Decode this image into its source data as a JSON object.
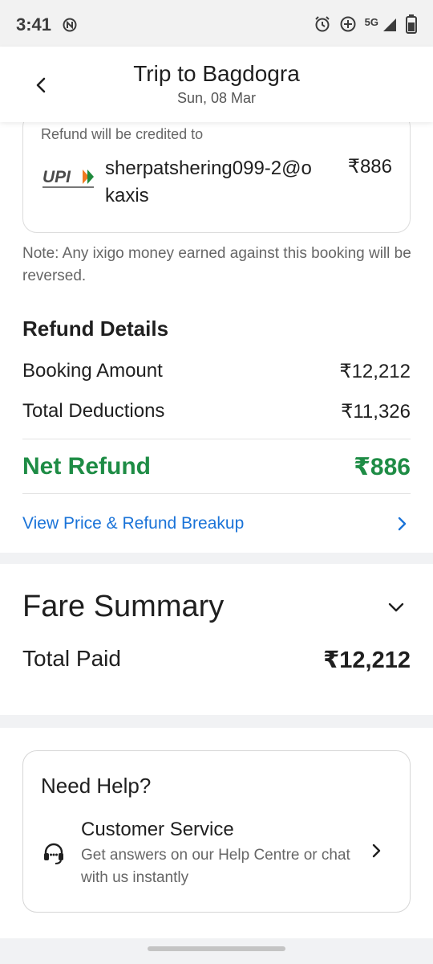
{
  "status_bar": {
    "time": "3:41",
    "network": "5G",
    "icons": [
      "alarm-icon",
      "data-saver-icon",
      "signal-icon",
      "battery-icon"
    ]
  },
  "header": {
    "title": "Trip to Bagdogra",
    "subtitle": "Sun, 08 Mar"
  },
  "refund_destination": {
    "caption": "Refund will be credited to",
    "upi_id": "sherpatshering099-2@okaxis",
    "amount": "₹886"
  },
  "note": "Note: Any ixigo money earned against this booking will be reversed.",
  "refund_details": {
    "heading": "Refund Details",
    "rows": [
      {
        "label": "Booking Amount",
        "value": "₹12,212"
      },
      {
        "label": "Total Deductions",
        "value": "₹11,326"
      }
    ],
    "net_label": "Net Refund",
    "net_value": "₹886",
    "breakup_link": "View Price & Refund Breakup"
  },
  "fare_summary": {
    "title": "Fare Summary",
    "total_label": "Total Paid",
    "total_value": "₹12,212"
  },
  "help": {
    "title": "Need Help?",
    "service_title": "Customer Service",
    "service_desc": "Get answers on our Help Centre or chat with us instantly"
  },
  "colors": {
    "accent_green": "#1e8c45",
    "link_blue": "#1a73d8"
  }
}
